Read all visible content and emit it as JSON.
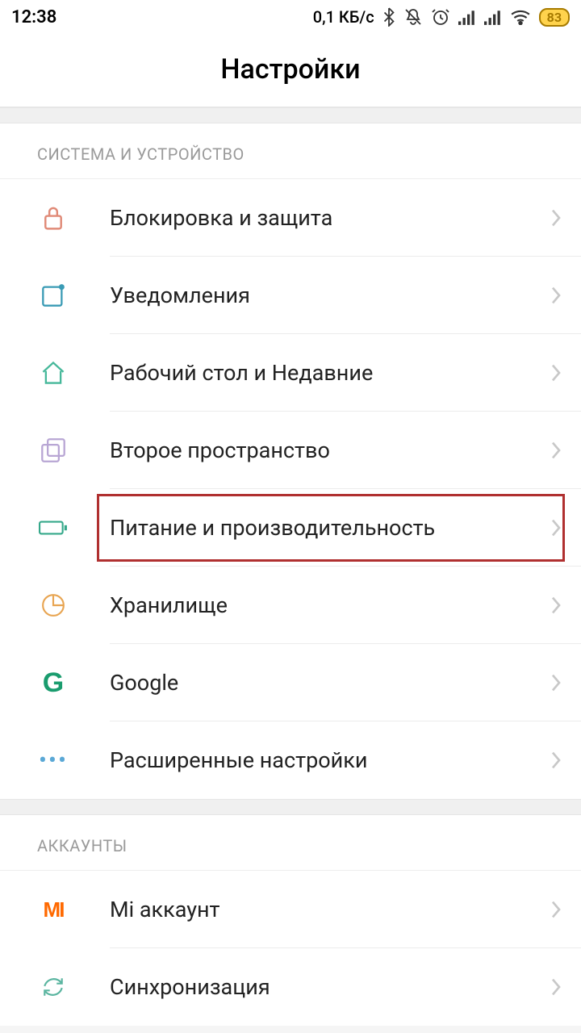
{
  "status": {
    "time": "12:38",
    "data_rate": "0,1 КБ/с",
    "battery": "83"
  },
  "header": {
    "title": "Настройки"
  },
  "sections": {
    "system": {
      "title": "СИСТЕМА И УСТРОЙСТВО",
      "items": [
        {
          "label": "Блокировка и защита"
        },
        {
          "label": "Уведомления"
        },
        {
          "label": "Рабочий стол и Недавние"
        },
        {
          "label": "Второе пространство"
        },
        {
          "label": "Питание и производительность"
        },
        {
          "label": "Хранилище"
        },
        {
          "label": "Google"
        },
        {
          "label": "Расширенные настройки"
        }
      ]
    },
    "accounts": {
      "title": "АККАУНТЫ",
      "items": [
        {
          "label": "Mi аккаунт"
        },
        {
          "label": "Синхронизация"
        }
      ]
    }
  }
}
